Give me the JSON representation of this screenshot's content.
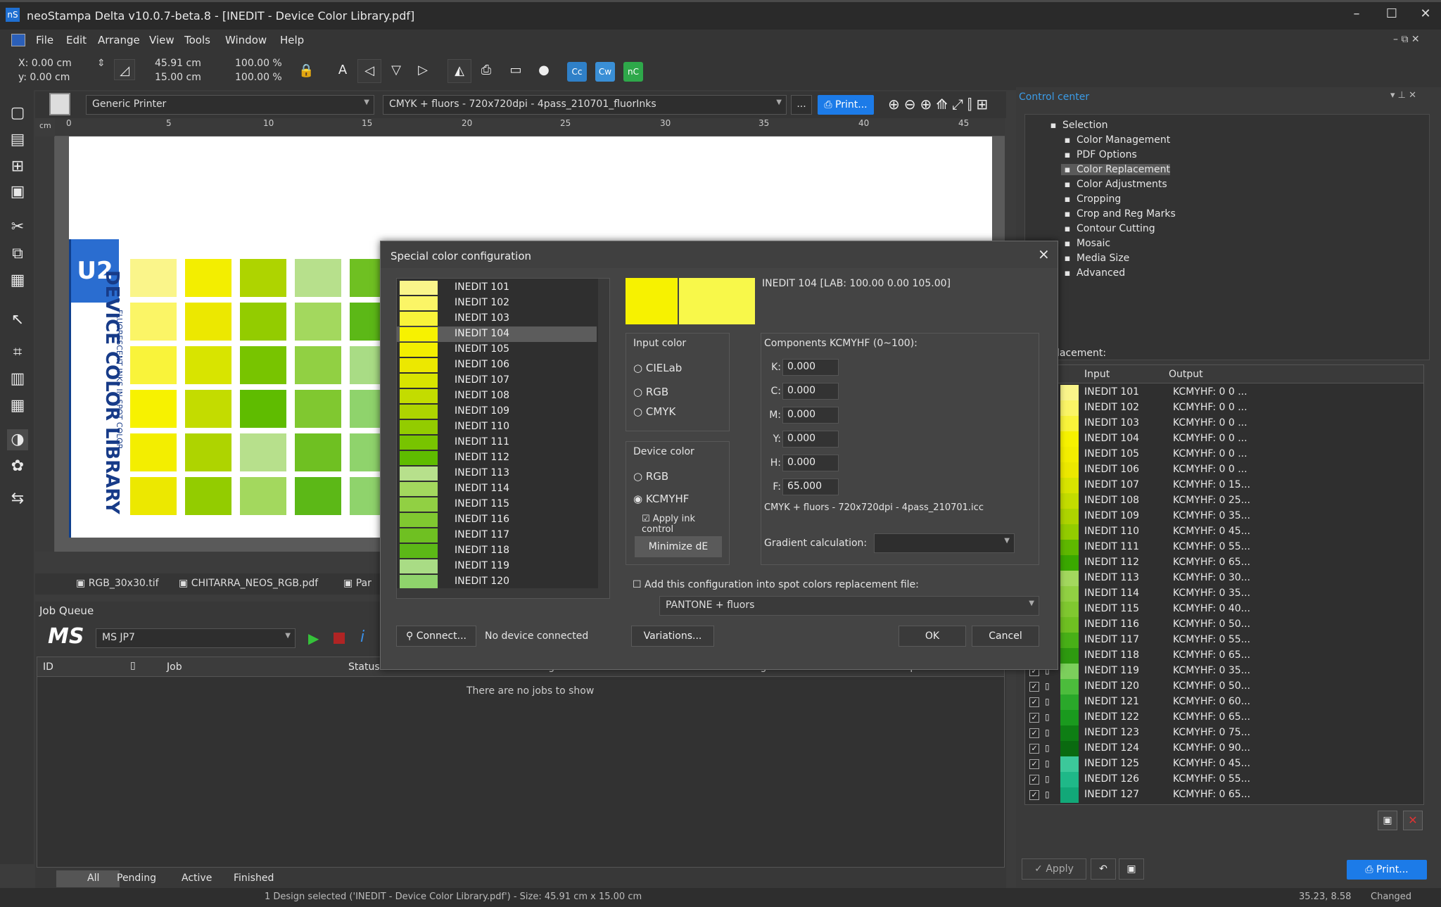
{
  "window": {
    "title": "neoStampa Delta  v10.0.7-beta.8 - [INEDIT - Device Color Library.pdf]"
  },
  "menu": [
    "File",
    "Edit",
    "Arrange",
    "View",
    "Tools",
    "Window",
    "Help"
  ],
  "toolbar": {
    "x": "X: 0.00 cm",
    "y": "y: 0.00 cm",
    "width": "45.91 cm",
    "height": "15.00 cm",
    "scale_x": "100.00 %",
    "scale_y": "100.00 %"
  },
  "docbar": {
    "printer": "Generic Printer",
    "profile": "CMYK + fluors - 720x720dpi - 4pass_210701_fluorInks",
    "more": "...",
    "print_label": "Print..."
  },
  "ruler": {
    "unit": "cm",
    "ticks": [
      "0",
      "5",
      "10",
      "15",
      "20",
      "25",
      "30",
      "35",
      "40",
      "45"
    ]
  },
  "artwork": {
    "badge": "U2",
    "label": "DEVICE COLOR LIBRARY",
    "sublabel": "FLUORESCENT INKS IN SPOT COLOR"
  },
  "file_tabs": [
    "RGB_30x30.tif",
    "CHITARRA_NEOS_RGB.pdf",
    "Par"
  ],
  "job_queue": {
    "title": "Job Queue",
    "logo": "MS",
    "queue": "MS JP7",
    "columns": [
      "ID",
      "Job",
      "Status",
      "Progress",
      "Remaining",
      "Copies"
    ],
    "empty": "There are no jobs to show",
    "tabs": [
      "All",
      "Pending",
      "Active",
      "Finished"
    ]
  },
  "dialog": {
    "title": "Special color configuration",
    "close": "×",
    "selected_info": "INEDIT 104  [LAB: 100.00 0.00 105.00]",
    "preview_colors": [
      "#f7f200",
      "#f8f84a"
    ],
    "list": [
      {
        "name": "INEDIT 101",
        "color": "#faf58a"
      },
      {
        "name": "INEDIT 102",
        "color": "#fbf566"
      },
      {
        "name": "INEDIT 103",
        "color": "#f9f33a"
      },
      {
        "name": "INEDIT 104",
        "color": "#f7f200"
      },
      {
        "name": "INEDIT 105",
        "color": "#f3ee00"
      },
      {
        "name": "INEDIT 106",
        "color": "#ece800"
      },
      {
        "name": "INEDIT 107",
        "color": "#d8e400"
      },
      {
        "name": "INEDIT 108",
        "color": "#c3dc00"
      },
      {
        "name": "INEDIT 109",
        "color": "#aed400"
      },
      {
        "name": "INEDIT 110",
        "color": "#93cc00"
      },
      {
        "name": "INEDIT 111",
        "color": "#78c400"
      },
      {
        "name": "INEDIT 112",
        "color": "#5fbc00"
      },
      {
        "name": "INEDIT 113",
        "color": "#b7e08c"
      },
      {
        "name": "INEDIT 114",
        "color": "#a3d85e"
      },
      {
        "name": "INEDIT 115",
        "color": "#91d043"
      },
      {
        "name": "INEDIT 116",
        "color": "#80c830"
      },
      {
        "name": "INEDIT 117",
        "color": "#6fc022"
      },
      {
        "name": "INEDIT 118",
        "color": "#5cb817"
      },
      {
        "name": "INEDIT 119",
        "color": "#a9dc85"
      },
      {
        "name": "INEDIT 120",
        "color": "#8fd36c"
      }
    ],
    "input_color": {
      "title": "Input color",
      "options": [
        "CIELab",
        "RGB",
        "CMYK"
      ]
    },
    "device_color": {
      "title": "Device color",
      "options": [
        "RGB",
        "KCMYHF"
      ],
      "selected": "KCMYHF",
      "apply_ink": "Apply ink control",
      "minimize": "Minimize dE"
    },
    "components": {
      "title": "Components KCMYHF (0~100):",
      "fields": [
        {
          "label": "K:",
          "value": "0.000"
        },
        {
          "label": "C:",
          "value": "0.000"
        },
        {
          "label": "M:",
          "value": "0.000"
        },
        {
          "label": "Y:",
          "value": "0.000"
        },
        {
          "label": "H:",
          "value": "0.000"
        },
        {
          "label": "F:",
          "value": "65.000"
        }
      ],
      "profile": "CMYK + fluors - 720x720dpi - 4pass_210701.icc",
      "gradient_label": "Gradient calculation:"
    },
    "spot_checkbox": "Add this configuration into spot colors replacement file:",
    "spot_file": "PANTONE + fluors",
    "connect": "Connect...",
    "device_status": "No device connected",
    "variations": "Variations...",
    "ok": "OK",
    "cancel": "Cancel"
  },
  "control_center": {
    "title": "Control center",
    "tree": [
      {
        "label": "Selection",
        "icon": "selection-icon"
      },
      {
        "label": "Color Management",
        "icon": "icc-icon"
      },
      {
        "label": "PDF Options",
        "icon": "pdf-icon"
      },
      {
        "label": "Color Replacement",
        "icon": "color-replacement-icon"
      },
      {
        "label": "Color Adjustments",
        "icon": "adjust-icon"
      },
      {
        "label": "Cropping",
        "icon": "crop-icon"
      },
      {
        "label": "Crop and Reg Marks",
        "icon": "marks-icon"
      },
      {
        "label": "Contour Cutting",
        "icon": "contour-icon"
      },
      {
        "label": "Mosaic",
        "icon": "mosaic-icon"
      },
      {
        "label": "Media Size",
        "icon": "media-icon"
      },
      {
        "label": "Advanced",
        "icon": "info-icon"
      }
    ],
    "section": "lacement:",
    "columns": [
      "Input",
      "Output"
    ],
    "rows": [
      {
        "input": "INEDIT 101",
        "output": "KCMYHF:  0 0 ...",
        "color": "#faf58a"
      },
      {
        "input": "INEDIT 102",
        "output": "KCMYHF:  0 0 ...",
        "color": "#fbf566"
      },
      {
        "input": "INEDIT 103",
        "output": "KCMYHF:  0 0 ...",
        "color": "#f9f33a"
      },
      {
        "input": "INEDIT 104",
        "output": "KCMYHF:  0 0 ...",
        "color": "#f7f200"
      },
      {
        "input": "INEDIT 105",
        "output": "KCMYHF:  0 0 ...",
        "color": "#f3ee00"
      },
      {
        "input": "INEDIT 106",
        "output": "KCMYHF:  0 0 ...",
        "color": "#ece800"
      },
      {
        "input": "INEDIT 107",
        "output": "KCMYHF:  0 15...",
        "color": "#d8e400"
      },
      {
        "input": "INEDIT 108",
        "output": "KCMYHF:  0 25...",
        "color": "#c3dc00"
      },
      {
        "input": "INEDIT 109",
        "output": "KCMYHF:  0 35...",
        "color": "#aed400"
      },
      {
        "input": "INEDIT 110",
        "output": "KCMYHF:  0 45...",
        "color": "#93cc00"
      },
      {
        "input": "INEDIT 111",
        "output": "KCMYHF:  0 55...",
        "color": "#5fb800"
      },
      {
        "input": "INEDIT 112",
        "output": "KCMYHF:  0 65...",
        "color": "#3aa800"
      },
      {
        "input": "INEDIT 113",
        "output": "KCMYHF:  0 30...",
        "color": "#a3d85e"
      },
      {
        "input": "INEDIT 114",
        "output": "KCMYHF:  0 35...",
        "color": "#91d043"
      },
      {
        "input": "INEDIT 115",
        "output": "KCMYHF:  0 40...",
        "color": "#80c830"
      },
      {
        "input": "INEDIT 116",
        "output": "KCMYHF:  0 50...",
        "color": "#6fc022"
      },
      {
        "input": "INEDIT 117",
        "output": "KCMYHF:  0 55...",
        "color": "#48b017"
      },
      {
        "input": "INEDIT 118",
        "output": "KCMYHF:  0 65...",
        "color": "#2e9a10"
      },
      {
        "input": "INEDIT 119",
        "output": "KCMYHF:  0 35...",
        "color": "#7ccf5c"
      },
      {
        "input": "INEDIT 120",
        "output": "KCMYHF:  0 50...",
        "color": "#4cbc3c"
      },
      {
        "input": "INEDIT 121",
        "output": "KCMYHF:  0 60...",
        "color": "#2aa82a"
      },
      {
        "input": "INEDIT 122",
        "output": "KCMYHF:  0 65...",
        "color": "#1a9a1e"
      },
      {
        "input": "INEDIT 123",
        "output": "KCMYHF:  0 75...",
        "color": "#0e7e14"
      },
      {
        "input": "INEDIT 124",
        "output": "KCMYHF:  0 90...",
        "color": "#0a6a10"
      },
      {
        "input": "INEDIT 125",
        "output": "KCMYHF:  0 45...",
        "color": "#3cc89a"
      },
      {
        "input": "INEDIT 126",
        "output": "KCMYHF:  0 55...",
        "color": "#1fb888"
      },
      {
        "input": "INEDIT 127",
        "output": "KCMYHF:  0 65...",
        "color": "#12a878"
      }
    ],
    "apply": "Apply",
    "print": "Print..."
  },
  "status": {
    "left": "1 Design selected ('INEDIT - Device Color Library.pdf') - Size: 45.91 cm x 15.00 cm",
    "coords": "35.23, 8.58",
    "state": "Changed"
  }
}
